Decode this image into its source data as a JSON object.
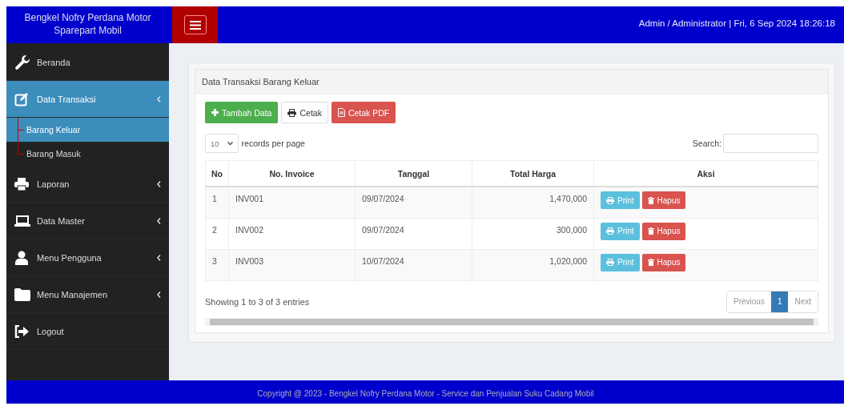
{
  "header": {
    "brand": "Bengkel Nofry Perdana Motor Sparepart Mobil",
    "user_info": "Admin / Administrator | Fri, 6 Sep 2024 18:26:18"
  },
  "sidebar": {
    "items": [
      {
        "label": "Beranda",
        "selected": false,
        "expandable": false
      },
      {
        "label": "Data Transaksi",
        "selected": true,
        "expandable": true,
        "children": [
          {
            "label": "Barang Keluar",
            "selected": true
          },
          {
            "label": "Barang Masuk",
            "selected": false
          }
        ]
      },
      {
        "label": "Laporan",
        "selected": false,
        "expandable": true
      },
      {
        "label": "Data Master",
        "selected": false,
        "expandable": true
      },
      {
        "label": "Menu Pengguna",
        "selected": false,
        "expandable": true
      },
      {
        "label": "Menu Manajemen",
        "selected": false,
        "expandable": true
      },
      {
        "label": "Logout",
        "selected": false,
        "expandable": false
      }
    ]
  },
  "panel": {
    "title": "Data Transaksi Barang Keluar",
    "buttons": [
      {
        "label": "Tambah Data",
        "kind": "add"
      },
      {
        "label": "Cetak",
        "kind": "print"
      },
      {
        "label": "Cetak PDF",
        "kind": "pdf"
      }
    ],
    "page_size": "10",
    "page_size_label": "records per page",
    "search_label": "Search:",
    "table": {
      "columns": [
        "No",
        "No. Invoice",
        "Tanggal",
        "Total Harga",
        "Aksi"
      ],
      "rows": [
        {
          "no": "1",
          "invoice": "INV001",
          "tanggal": "09/07/2024",
          "total": "1,470,000",
          "actions": [
            "Print",
            "Hapus"
          ]
        },
        {
          "no": "2",
          "invoice": "INV002",
          "tanggal": "09/07/2024",
          "total": "300,000",
          "actions": [
            "Print",
            "Hapus"
          ]
        },
        {
          "no": "3",
          "invoice": "INV003",
          "tanggal": "10/07/2024",
          "total": "1,020,000",
          "actions": [
            "Print",
            "Hapus"
          ]
        }
      ]
    },
    "info": "Showing 1 to 3 of 3 entries",
    "pagination": {
      "previous": "Previous",
      "pages": [
        {
          "label": "1",
          "selected": true
        }
      ],
      "next": "Next"
    }
  },
  "footer": "Copyright @ 2023 - Bengkel Nofry Perdana Motor - Service dan Penjualan Suku Cadang Mobil"
}
